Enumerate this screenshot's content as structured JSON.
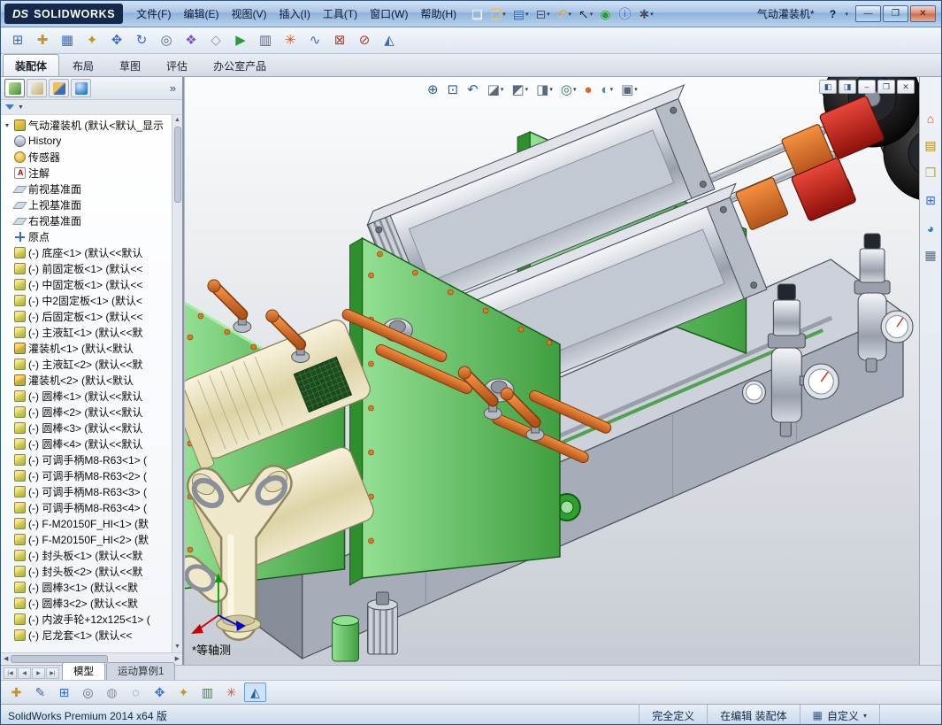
{
  "window": {
    "logo_mark": "DS",
    "logo_text": "SOLIDWORKS",
    "title": "气动灌装机*",
    "help": "?",
    "help_caret": "▾",
    "controls": [
      {
        "name": "minimize-button",
        "icon": "minimize-icon",
        "glyph": "—"
      },
      {
        "name": "maximize-button",
        "icon": "maximize-icon",
        "glyph": "❐"
      },
      {
        "name": "close-button",
        "icon": "close-icon",
        "glyph": "✕",
        "cls": "close"
      }
    ]
  },
  "menus": [
    "文件(F)",
    "编辑(E)",
    "视图(V)",
    "插入(I)",
    "工具(T)",
    "窗口(W)",
    "帮助(H)"
  ],
  "quickbar": [
    {
      "name": "new-document-button",
      "icon": "new-document-icon",
      "glyph": "❏",
      "color": "#f4f8ff",
      "caret": ""
    },
    {
      "name": "open-document-button",
      "icon": "open-folder-icon",
      "glyph": "❒",
      "color": "#e8b84a",
      "caret": "▾"
    },
    {
      "name": "save-button",
      "icon": "save-disk-icon",
      "glyph": "▤",
      "color": "#2f5fa8",
      "caret": "▾"
    },
    {
      "name": "print-button",
      "icon": "printer-icon",
      "glyph": "⊟",
      "color": "#44536b",
      "caret": "▾"
    },
    {
      "name": "undo-button",
      "icon": "undo-arrow-icon",
      "glyph": "↶",
      "color": "#d8a018",
      "caret": "▾"
    },
    {
      "name": "select-button",
      "icon": "cursor-icon",
      "glyph": "↖",
      "color": "#1c2a40",
      "caret": "▾"
    },
    {
      "name": "rebuild-button",
      "icon": "rebuild-icon",
      "glyph": "◉",
      "color": "#1fa32a",
      "caret": ""
    },
    {
      "name": "file-properties-button",
      "icon": "file-properties-icon",
      "glyph": "ⓘ",
      "color": "#2f5fa8",
      "caret": ""
    },
    {
      "name": "options-button",
      "icon": "options-gear-icon",
      "glyph": "✱",
      "color": "#44536b",
      "caret": "▾"
    }
  ],
  "toolbar2": [
    {
      "name": "insert-components-button",
      "icon": "insert-component-icon",
      "glyph": "⊞",
      "color": "#3a6bbf"
    },
    {
      "name": "mate-button",
      "icon": "mate-icon",
      "glyph": "✚",
      "color": "#c8941a"
    },
    {
      "name": "linear-component-pattern-button",
      "icon": "pattern-icon",
      "glyph": "▦",
      "color": "#3a6bbf"
    },
    {
      "name": "smart-fasteners-button",
      "icon": "smart-fastener-icon",
      "glyph": "✦",
      "color": "#c8941a"
    },
    {
      "name": "move-component-button",
      "icon": "move-component-icon",
      "glyph": "✥",
      "color": "#3a6bbf"
    },
    {
      "name": "rotate-component-button",
      "icon": "rotate-component-icon",
      "glyph": "↻",
      "color": "#3a6bbf"
    },
    {
      "name": "show-hidden-components-button",
      "icon": "show-hidden-icon",
      "glyph": "◎",
      "color": "#556a85"
    },
    {
      "name": "assembly-features-button",
      "icon": "assembly-features-icon",
      "glyph": "❖",
      "color": "#7a5abf"
    },
    {
      "name": "reference-geometry-button",
      "icon": "reference-geometry-icon",
      "glyph": "◇",
      "color": "#8a93a5"
    },
    {
      "name": "new-motion-study-button",
      "icon": "motion-study-icon",
      "glyph": "▶",
      "color": "#2a9a3a"
    },
    {
      "name": "bill-of-materials-button",
      "icon": "bom-icon",
      "glyph": "▥",
      "color": "#556a85"
    },
    {
      "name": "exploded-view-button",
      "icon": "exploded-view-icon",
      "glyph": "✳",
      "color": "#c85a2a"
    },
    {
      "name": "explode-line-sketch-button",
      "icon": "explode-line-icon",
      "glyph": "∿",
      "color": "#3a6bbf"
    },
    {
      "name": "interference-detection-button",
      "icon": "interference-icon",
      "glyph": "⊠",
      "color": "#b33a2a"
    },
    {
      "name": "clearance-verification-button",
      "icon": "clearance-icon",
      "glyph": "⊘",
      "color": "#b33a2a"
    },
    {
      "name": "instant3d-button",
      "icon": "instant3d-icon",
      "glyph": "◭",
      "color": "#3a6bbf"
    }
  ],
  "command_tabs": [
    {
      "name": "tab-assembly",
      "label": "装配体",
      "state": "active"
    },
    {
      "name": "tab-layout",
      "label": "布局",
      "state": ""
    },
    {
      "name": "tab-sketch",
      "label": "草图",
      "state": ""
    },
    {
      "name": "tab-evaluate",
      "label": "评估",
      "state": ""
    },
    {
      "name": "tab-office-products",
      "label": "办公室产品",
      "state": ""
    }
  ],
  "panel": {
    "chevron": "»",
    "filter_caret": "▼",
    "root_expander": "▾",
    "root_label": "气动灌装机 (默认<默认_显示",
    "scroll": {
      "up": "▲",
      "down": "▼",
      "left": "◀",
      "right": "▶"
    },
    "items": [
      {
        "icon_class": "ic-history",
        "icon": "history-folder-icon",
        "label": "History"
      },
      {
        "icon_class": "ic-sensors",
        "icon": "sensors-icon",
        "label": "传感器"
      },
      {
        "icon_class": "ic-annotations",
        "icon": "annotations-icon",
        "label": "注解"
      },
      {
        "icon_class": "ic-plane",
        "icon": "plane-icon",
        "label": "前视基准面"
      },
      {
        "icon_class": "ic-plane",
        "icon": "plane-icon",
        "label": "上视基准面"
      },
      {
        "icon_class": "ic-plane",
        "icon": "plane-icon",
        "label": "右视基准面"
      },
      {
        "icon_class": "ic-origin",
        "icon": "origin-icon",
        "label": "原点"
      },
      {
        "icon_class": "ic-part",
        "icon": "part-icon",
        "label": "(-) 底座<1> (默认<<默认"
      },
      {
        "icon_class": "ic-part",
        "icon": "part-icon",
        "label": "(-) 前固定板<1> (默认<<"
      },
      {
        "icon_class": "ic-part",
        "icon": "part-icon",
        "label": "(-) 中固定板<1> (默认<<"
      },
      {
        "icon_class": "ic-part",
        "icon": "part-icon",
        "label": "(-) 中2固定板<1> (默认<"
      },
      {
        "icon_class": "ic-part",
        "icon": "part-icon",
        "label": "(-) 后固定板<1> (默认<<"
      },
      {
        "icon_class": "ic-part",
        "icon": "part-icon",
        "label": "(-) 主液缸<1> (默认<<默"
      },
      {
        "icon_class": "ic-subasm",
        "icon": "subassembly-icon",
        "label": "灌装机<1> (默认<默认"
      },
      {
        "icon_class": "ic-part",
        "icon": "part-icon",
        "label": "(-) 主液缸<2> (默认<<默"
      },
      {
        "icon_class": "ic-subasm",
        "icon": "subassembly-icon",
        "label": "灌装机<2> (默认<默认"
      },
      {
        "icon_class": "ic-part",
        "icon": "part-icon",
        "label": "(-) 圆棒<1> (默认<<默认"
      },
      {
        "icon_class": "ic-part",
        "icon": "part-icon",
        "label": "(-) 圆棒<2> (默认<<默认"
      },
      {
        "icon_class": "ic-part",
        "icon": "part-icon",
        "label": "(-) 圆棒<3> (默认<<默认"
      },
      {
        "icon_class": "ic-part",
        "icon": "part-icon",
        "label": "(-) 圆棒<4> (默认<<默认"
      },
      {
        "icon_class": "ic-part",
        "icon": "part-icon",
        "label": "(-) 可调手柄M8-R63<1> ("
      },
      {
        "icon_class": "ic-part",
        "icon": "part-icon",
        "label": "(-) 可调手柄M8-R63<2> ("
      },
      {
        "icon_class": "ic-part",
        "icon": "part-icon",
        "label": "(-) 可调手柄M8-R63<3> ("
      },
      {
        "icon_class": "ic-part",
        "icon": "part-icon",
        "label": "(-) 可调手柄M8-R63<4> ("
      },
      {
        "icon_class": "ic-part",
        "icon": "part-icon",
        "label": "(-) F-M20150F_HI<1> (默"
      },
      {
        "icon_class": "ic-part",
        "icon": "part-icon",
        "label": "(-) F-M20150F_HI<2> (默"
      },
      {
        "icon_class": "ic-part",
        "icon": "part-icon",
        "label": "(-) 封头板<1> (默认<<默"
      },
      {
        "icon_class": "ic-part",
        "icon": "part-icon",
        "label": "(-) 封头板<2> (默认<<默"
      },
      {
        "icon_class": "ic-part",
        "icon": "part-icon",
        "label": "(-) 圆棒3<1> (默认<<默"
      },
      {
        "icon_class": "ic-part",
        "icon": "part-icon",
        "label": "(-) 圆棒3<2> (默认<<默"
      },
      {
        "icon_class": "ic-part",
        "icon": "part-icon",
        "label": "(-) 内波手轮+12x125<1> ("
      },
      {
        "icon_class": "ic-part",
        "icon": "part-icon",
        "label": "(-) 尼龙套<1> (默认<<"
      }
    ]
  },
  "viewport": {
    "view_label": "*等轴测",
    "headsup": [
      {
        "name": "zoom-fit-button",
        "icon": "zoom-fit-icon",
        "glyph": "⊕",
        "color": "#2a5d9f",
        "caret": ""
      },
      {
        "name": "zoom-area-button",
        "icon": "zoom-area-icon",
        "glyph": "⊡",
        "color": "#2a5d9f",
        "caret": ""
      },
      {
        "name": "previous-view-button",
        "icon": "previous-view-icon",
        "glyph": "↶",
        "color": "#2a5d9f",
        "caret": ""
      },
      {
        "name": "section-view-button",
        "icon": "section-view-icon",
        "glyph": "◪",
        "color": "#5a6a7a",
        "caret": "▾"
      },
      {
        "name": "view-orientation-button",
        "icon": "view-cube-icon",
        "glyph": "◩",
        "color": "#5a6a7a",
        "caret": "▾"
      },
      {
        "name": "display-style-button",
        "icon": "display-style-icon",
        "glyph": "◨",
        "color": "#5a6a7a",
        "caret": "▾"
      },
      {
        "name": "hide-show-items-button",
        "icon": "hide-show-icon",
        "glyph": "◎",
        "color": "#2a7d5f",
        "caret": "▾"
      },
      {
        "name": "edit-appearance-button",
        "icon": "appearance-ball-icon",
        "glyph": "●",
        "color": "#d06a2a",
        "caret": ""
      },
      {
        "name": "apply-scene-button",
        "icon": "scene-ball-icon",
        "glyph": "◐",
        "color": "#3a87c8",
        "caret": "▾"
      },
      {
        "name": "view-settings-button",
        "icon": "view-settings-icon",
        "glyph": "▣",
        "color": "#5a6a7a",
        "caret": "▾"
      }
    ],
    "childwin": [
      {
        "name": "pane-left-button",
        "icon": "pane-left-icon",
        "glyph": "◧",
        "color": "#2a5d9f"
      },
      {
        "name": "pane-right-button",
        "icon": "pane-right-icon",
        "glyph": "◨",
        "color": "#2a5d9f"
      },
      {
        "name": "minimize-doc-button",
        "icon": "minimize-icon",
        "glyph": "–",
        "color": "#444"
      },
      {
        "name": "restore-doc-button",
        "icon": "restore-icon",
        "glyph": "❐",
        "color": "#444"
      },
      {
        "name": "close-doc-button",
        "icon": "close-icon",
        "glyph": "✕",
        "color": "#444"
      }
    ]
  },
  "taskpane": [
    {
      "name": "solidworks-resources-tab",
      "icon": "home-icon",
      "glyph": "⌂",
      "color": "#c05a1e"
    },
    {
      "name": "design-library-tab",
      "icon": "design-library-icon",
      "glyph": "▤",
      "color": "#b08a2a"
    },
    {
      "name": "file-explorer-tab",
      "icon": "folder-icon",
      "glyph": "❒",
      "color": "#c8a23a"
    },
    {
      "name": "view-palette-tab",
      "icon": "view-palette-icon",
      "glyph": "⊞",
      "color": "#3a6bbf"
    },
    {
      "name": "appearances-scenes-tab",
      "icon": "appearance-sphere-icon",
      "glyph": "◕",
      "color": "#2e7dd1"
    },
    {
      "name": "custom-properties-tab",
      "icon": "custom-properties-icon",
      "glyph": "▦",
      "color": "#5a6a7a"
    }
  ],
  "model_tabs": {
    "nav": [
      {
        "name": "first-tab-button",
        "icon": "first-tab-icon",
        "glyph": "|◀"
      },
      {
        "name": "prev-tab-button",
        "icon": "prev-tab-icon",
        "glyph": "◀"
      },
      {
        "name": "next-tab-button",
        "icon": "next-tab-icon",
        "glyph": "▶"
      },
      {
        "name": "last-tab-button",
        "icon": "last-tab-icon",
        "glyph": "▶|"
      }
    ],
    "tabs": [
      {
        "name": "tab-model",
        "label": "模型",
        "state": "active"
      },
      {
        "name": "tab-motion-study-1",
        "label": "运动算例1",
        "state": ""
      }
    ]
  },
  "bottom_toolbar": [
    {
      "name": "mate-bottom-button",
      "icon": "mate-icon",
      "glyph": "✚",
      "color": "#c8941a",
      "state": ""
    },
    {
      "name": "edit-component-button",
      "icon": "edit-component-icon",
      "glyph": "✎",
      "color": "#3a6bbf",
      "state": ""
    },
    {
      "name": "insert-components-bottom-button",
      "icon": "insert-component-icon",
      "glyph": "⊞",
      "color": "#3a6bbf",
      "state": ""
    },
    {
      "name": "hide-show-components-button",
      "icon": "hide-show-icon",
      "glyph": "◎",
      "color": "#556a85",
      "state": ""
    },
    {
      "name": "change-transparency-button",
      "icon": "transparency-icon",
      "glyph": "◍",
      "color": "#8a93a5",
      "state": ""
    },
    {
      "name": "isolate-button",
      "icon": "isolate-icon",
      "glyph": "◌",
      "color": "#556a85",
      "state": ""
    },
    {
      "name": "move-component-bottom-button",
      "icon": "move-component-icon",
      "glyph": "✥",
      "color": "#3a6bbf",
      "state": ""
    },
    {
      "name": "smart-fasteners-bottom-button",
      "icon": "smart-fastener-icon",
      "glyph": "✦",
      "color": "#c8941a",
      "state": ""
    },
    {
      "name": "assembly-visualization-button",
      "icon": "assembly-visualization-icon",
      "glyph": "▥",
      "color": "#2a9a3a",
      "state": ""
    },
    {
      "name": "exploded-view-bottom-button",
      "icon": "exploded-view-icon",
      "glyph": "✳",
      "color": "#c85a2a",
      "state": ""
    },
    {
      "name": "instant3d-bottom-button",
      "icon": "instant3d-icon",
      "glyph": "◭",
      "color": "#2a5d9f",
      "state": "active"
    }
  ],
  "statusbar": {
    "left": "SolidWorks Premium 2014 x64 版",
    "fully_defined": "完全定义",
    "editing": "在编辑 装配体",
    "custom_icon": "▦",
    "custom": "自定义",
    "caret": "▾"
  }
}
